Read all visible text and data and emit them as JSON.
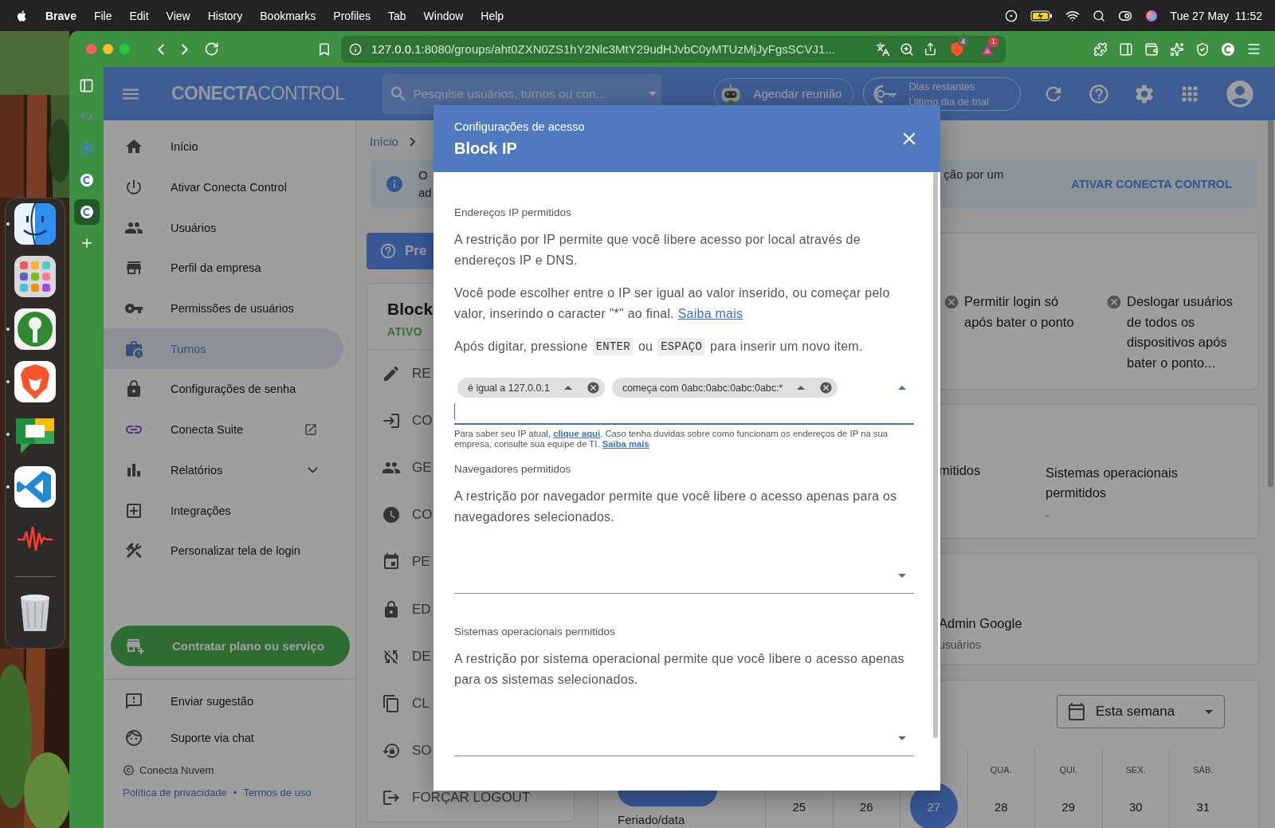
{
  "menu_bar": {
    "app_name": "Brave",
    "menus": [
      "File",
      "Edit",
      "View",
      "History",
      "Bookmarks",
      "Profiles",
      "Tab",
      "Window",
      "Help"
    ],
    "date": "Tue 27 May",
    "time": "11:52"
  },
  "dock": {
    "apps": [
      {
        "kind": "face",
        "running": true
      },
      {
        "kind": "grid",
        "running": false
      },
      {
        "kind": "key",
        "running": true
      },
      {
        "kind": "lion",
        "running": true
      },
      {
        "kind": "chat",
        "running": true
      },
      {
        "kind": "code",
        "running": true
      },
      {
        "kind": "waveform",
        "running": false
      },
      {
        "kind": "trash",
        "running": false
      }
    ]
  },
  "browser": {
    "url_host": "127.0.0.1",
    "url_rest": ":8080/groups/aht0ZXN0ZS1hY2Nlc3MtY29udHJvbC0yMTUzMjJyFgsSCVJ1...",
    "shield_badge": "4",
    "rewards_badge": "1",
    "tabs": [
      {
        "kind": "suite",
        "selected": false
      },
      {
        "kind": "ring",
        "selected": false
      },
      {
        "kind": "logo",
        "selected": false
      },
      {
        "kind": "logo",
        "selected": true
      }
    ]
  },
  "app_header": {
    "logo": "**CONECTA**CONTROL",
    "search_placeholder": "Pesquise usuários, turnos ou con...",
    "meeting_button": "Agendar reunião",
    "trial_title": "Dias restantes",
    "trial_subtitle": "Último dia de trial"
  },
  "sidebar": {
    "items": [
      {
        "kind": "home",
        "label": "Início",
        "selected": false
      },
      {
        "kind": "power",
        "label": "Ativar Conecta Control",
        "selected": false
      },
      {
        "kind": "users",
        "label": "Usuários",
        "selected": false
      },
      {
        "kind": "store",
        "label": "Perfil da empresa",
        "selected": false
      },
      {
        "kind": "key",
        "label": "Permissões de usuários",
        "selected": false
      },
      {
        "kind": "shifts",
        "label": "Turnos",
        "selected": true
      },
      {
        "kind": "lock",
        "label": "Configurações de senha",
        "selected": false
      },
      {
        "kind": "suite",
        "label": "Conecta Suite",
        "selected": false
      },
      {
        "kind": "reports",
        "label": "Relatórios",
        "selected": false,
        "expanded": false
      },
      {
        "kind": "integrations",
        "label": "Integrações",
        "selected": false
      },
      {
        "kind": "tools",
        "label": "Personalizar tela de login",
        "selected": false
      }
    ],
    "cta": "Contratar plano ou serviço",
    "bottom_items": [
      {
        "kind": "feedback",
        "label": "Enviar sugestão"
      },
      {
        "kind": "face",
        "label": "Suporte via chat"
      }
    ],
    "footer": {
      "company": "Conecta Nuvem",
      "links": [
        "Política de privacidade",
        "Termos de uso"
      ],
      "separator": "•"
    }
  },
  "main": {
    "breadcrumb": "Início",
    "alert": {
      "left_lines": [
        "O",
        "ad"
      ],
      "right_text": "ção por um",
      "action": "ATIVAR CONECTA CONTROL"
    },
    "help_button": "Pre",
    "group_card": {
      "title": "Block",
      "status": "ATIVO",
      "actions": [
        {
          "kind": "edit",
          "label": "RE"
        },
        {
          "kind": "login",
          "label": "CO"
        },
        {
          "kind": "group",
          "label": "GE"
        },
        {
          "kind": "clock",
          "label": "CO"
        },
        {
          "kind": "event",
          "label": "PE"
        },
        {
          "kind": "lock",
          "label": "ED"
        },
        {
          "kind": "sync_off",
          "label": "DE"
        },
        {
          "kind": "copy",
          "label": "CL"
        },
        {
          "kind": "lock_reset",
          "label": "SO"
        },
        {
          "kind": "logout",
          "label": "FORÇAR LOGOUT"
        }
      ]
    },
    "settings_card": {
      "items": [
        {
          "enabled": false,
          "text": "Permitir login só após bater o ponto"
        },
        {
          "enabled": false,
          "text": "Deslogar usuários de todos os dispositivos após bater o ponto..."
        }
      ]
    },
    "restrictions_card": {
      "fragment": "mitidos",
      "title": "Sistemas operacionais permitidos",
      "value": "-"
    },
    "admin_card": {
      "title": "Admin Google",
      "subtitle": "usuários"
    },
    "calendar": {
      "period": "Esta semana",
      "row_label": "Feriado/data",
      "days": [
        {
          "date": "25",
          "selected": false
        },
        {
          "date": "26",
          "selected": false
        },
        {
          "date": "27",
          "selected": true
        },
        {
          "weekday": "QUA.",
          "date": "28",
          "selected": false
        },
        {
          "weekday": "QUI.",
          "date": "29",
          "selected": false
        },
        {
          "weekday": "SEX.",
          "date": "30",
          "selected": false
        },
        {
          "weekday": "SÁB.",
          "date": "31",
          "selected": false
        }
      ]
    }
  },
  "modal": {
    "subtitle": "Configurações de acesso",
    "title": "Block IP",
    "ip_section": {
      "label": "Endereços IP permitidos",
      "description": "A restrição por IP permite que você libere acesso por local através de endereços IP e DNS.",
      "note": "Você pode escolher entre o IP ser igual ao valor inserido, ou começar pelo valor, inserindo o caracter \"*\" ao final.",
      "note_link": "Saiba mais",
      "hint": [
        {
          "kind": "text",
          "text": "Após digitar, pressione"
        },
        {
          "kind": "key",
          "text": "ENTER"
        },
        {
          "kind": "text",
          "text": "ou"
        },
        {
          "kind": "key",
          "text": "ESPAÇO"
        },
        {
          "kind": "text",
          "text": "para inserir um novo item."
        }
      ],
      "chips": [
        {
          "text": "é igual a 127.0.0.1"
        },
        {
          "text": "começa com 0abc:0abc:0abc:0abc:*"
        }
      ],
      "menu_open": true,
      "focused": true,
      "helper_before": "Para saber seu IP atual,",
      "helper_link": "clique aqui",
      "helper_after": ". Caso tenha duvidas sobre como funcionam os endereços de IP na sua empresa, consulte sua equipe de TI.",
      "helper_link2": "Saiba mais"
    },
    "select_sections": [
      {
        "label": "Navegadores permitidos",
        "description": "A restrição por navegador permite que você libere o acesso apenas para os navegadores selecionados.",
        "menu_open": false
      },
      {
        "label": "Sistemas operacionais permitidos",
        "description": "A restrição por sistema operacional permite que você libere o acesso apenas para os sistemas selecionados.",
        "menu_open": false
      }
    ]
  }
}
